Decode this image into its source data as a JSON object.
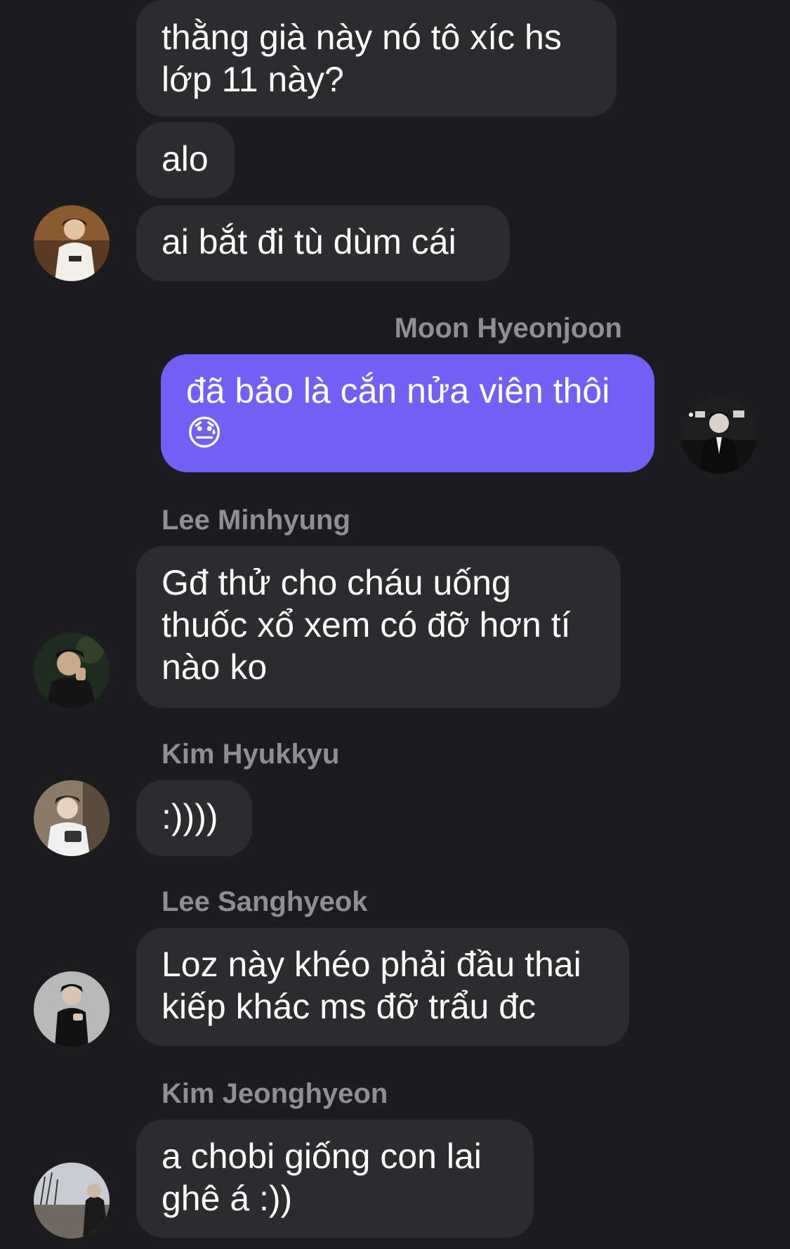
{
  "messages": [
    {
      "text": "thằng già này nó tô xíc hs lớp 11 này?"
    },
    {
      "text": "alo"
    },
    {
      "text": "ai bắt đi tù dùm cái"
    },
    {
      "sender": "Moon Hyeonjoon",
      "text": "đã bảo là cắn nửa viên thôi",
      "emoji": "😓"
    },
    {
      "sender": "Lee Minhyung",
      "text": "Gđ thử cho cháu uống thuốc xổ xem có đỡ hơn tí nào ko"
    },
    {
      "sender": "Kim Hyukkyu",
      "text": ":))))"
    },
    {
      "sender": "Lee Sanghyeok",
      "text": "Loz này khéo phải đầu thai kiếp khác ms đỡ trẩu đc"
    },
    {
      "sender": "Kim Jeonghyeon",
      "text": "a chobi giống con lai ghê á :))"
    }
  ],
  "colors": {
    "background": "#1c1c1e",
    "incoming_bubble": "#2c2c2e",
    "outgoing_bubble": "#7260f5",
    "sender_name": "#8e8e93"
  }
}
